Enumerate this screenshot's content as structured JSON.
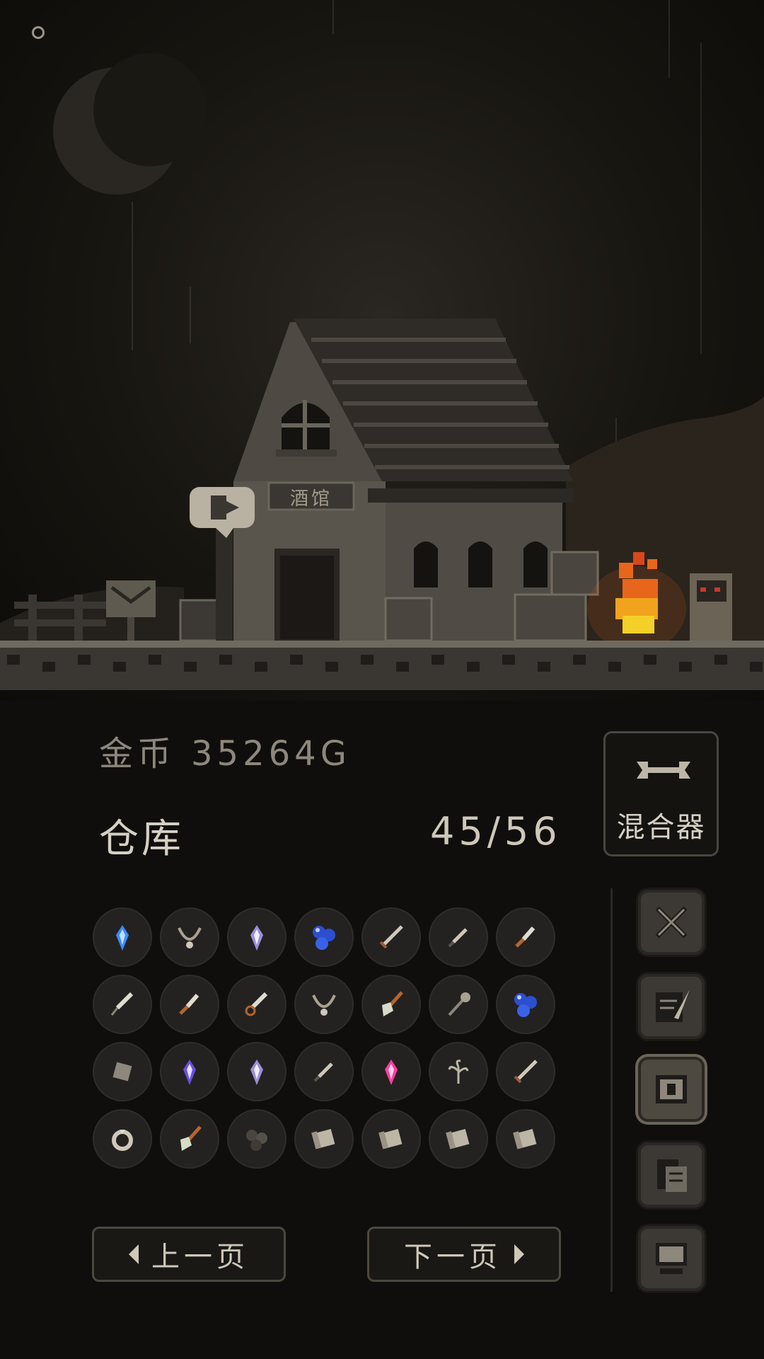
{
  "scene": {
    "tavern_sign": "酒馆"
  },
  "currency": {
    "label": "金币",
    "amount": "35264G"
  },
  "warehouse": {
    "title": "仓库",
    "capacity": "45/56"
  },
  "mixer": {
    "label": "混合器"
  },
  "items": [
    "blue-crystal-icon",
    "necklace-icon",
    "white-crystal-icon",
    "blue-orb-cluster-icon",
    "sword-icon",
    "dagger-icon",
    "knife-icon",
    "saw-dagger-icon",
    "knife-icon",
    "saw-blade-icon",
    "necklace-icon",
    "shovel-icon",
    "mace-icon",
    "blue-orb-cluster-icon",
    "stone-cube-icon",
    "purple-crystal-icon",
    "white-crystal-icon",
    "dagger-icon",
    "pink-crystal-icon",
    "herb-icon",
    "sword-icon",
    "ring-icon",
    "shovel-icon",
    "ore-icon",
    "scroll-icon",
    "scroll-icon",
    "scroll-icon",
    "scroll-icon"
  ],
  "pagination": {
    "prev_label": "上一页",
    "next_label": "下一页"
  },
  "side_tabs": [
    "crossed-swords-icon",
    "quill-scroll-icon",
    "warehouse-map-icon",
    "documents-icon",
    "computer-icon"
  ],
  "colors": {
    "fire": "#e8661c",
    "crystal_blue": "#3d8bff",
    "orb_blue": "#2c4fd0",
    "crystal_pink": "#ff3fa0"
  }
}
